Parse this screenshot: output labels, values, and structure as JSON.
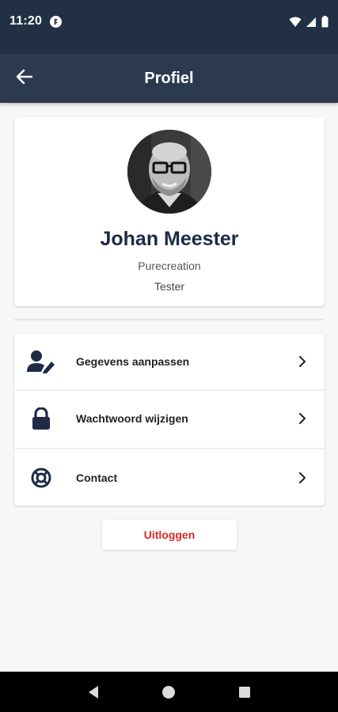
{
  "status_bar": {
    "time": "11:20",
    "icons": [
      "app-notification-icon",
      "wifi-icon",
      "cellular-signal-icon",
      "battery-icon"
    ]
  },
  "app_bar": {
    "title": "Profiel",
    "back_icon": "arrow-back-icon"
  },
  "profile": {
    "name": "Johan Meester",
    "company": "Purecreation",
    "role": "Tester",
    "avatar_icon": "profile-photo"
  },
  "menu": {
    "items": [
      {
        "label": "Gegevens aanpassen",
        "icon": "user-edit-icon"
      },
      {
        "label": "Wachtwoord wijzigen",
        "icon": "lock-icon"
      },
      {
        "label": "Contact",
        "icon": "lifebuoy-icon"
      }
    ]
  },
  "logout": {
    "label": "Uitloggen"
  },
  "colors": {
    "app_bar": "#2b3a4f",
    "status_bar": "#223044",
    "name_text": "#1c2a48",
    "icon": "#1f2b47",
    "logout_text": "#e0262b",
    "background": "#f7f7f8"
  },
  "nav_bar": {
    "buttons": [
      "back-triangle-icon",
      "home-circle-icon",
      "recents-square-icon"
    ]
  }
}
